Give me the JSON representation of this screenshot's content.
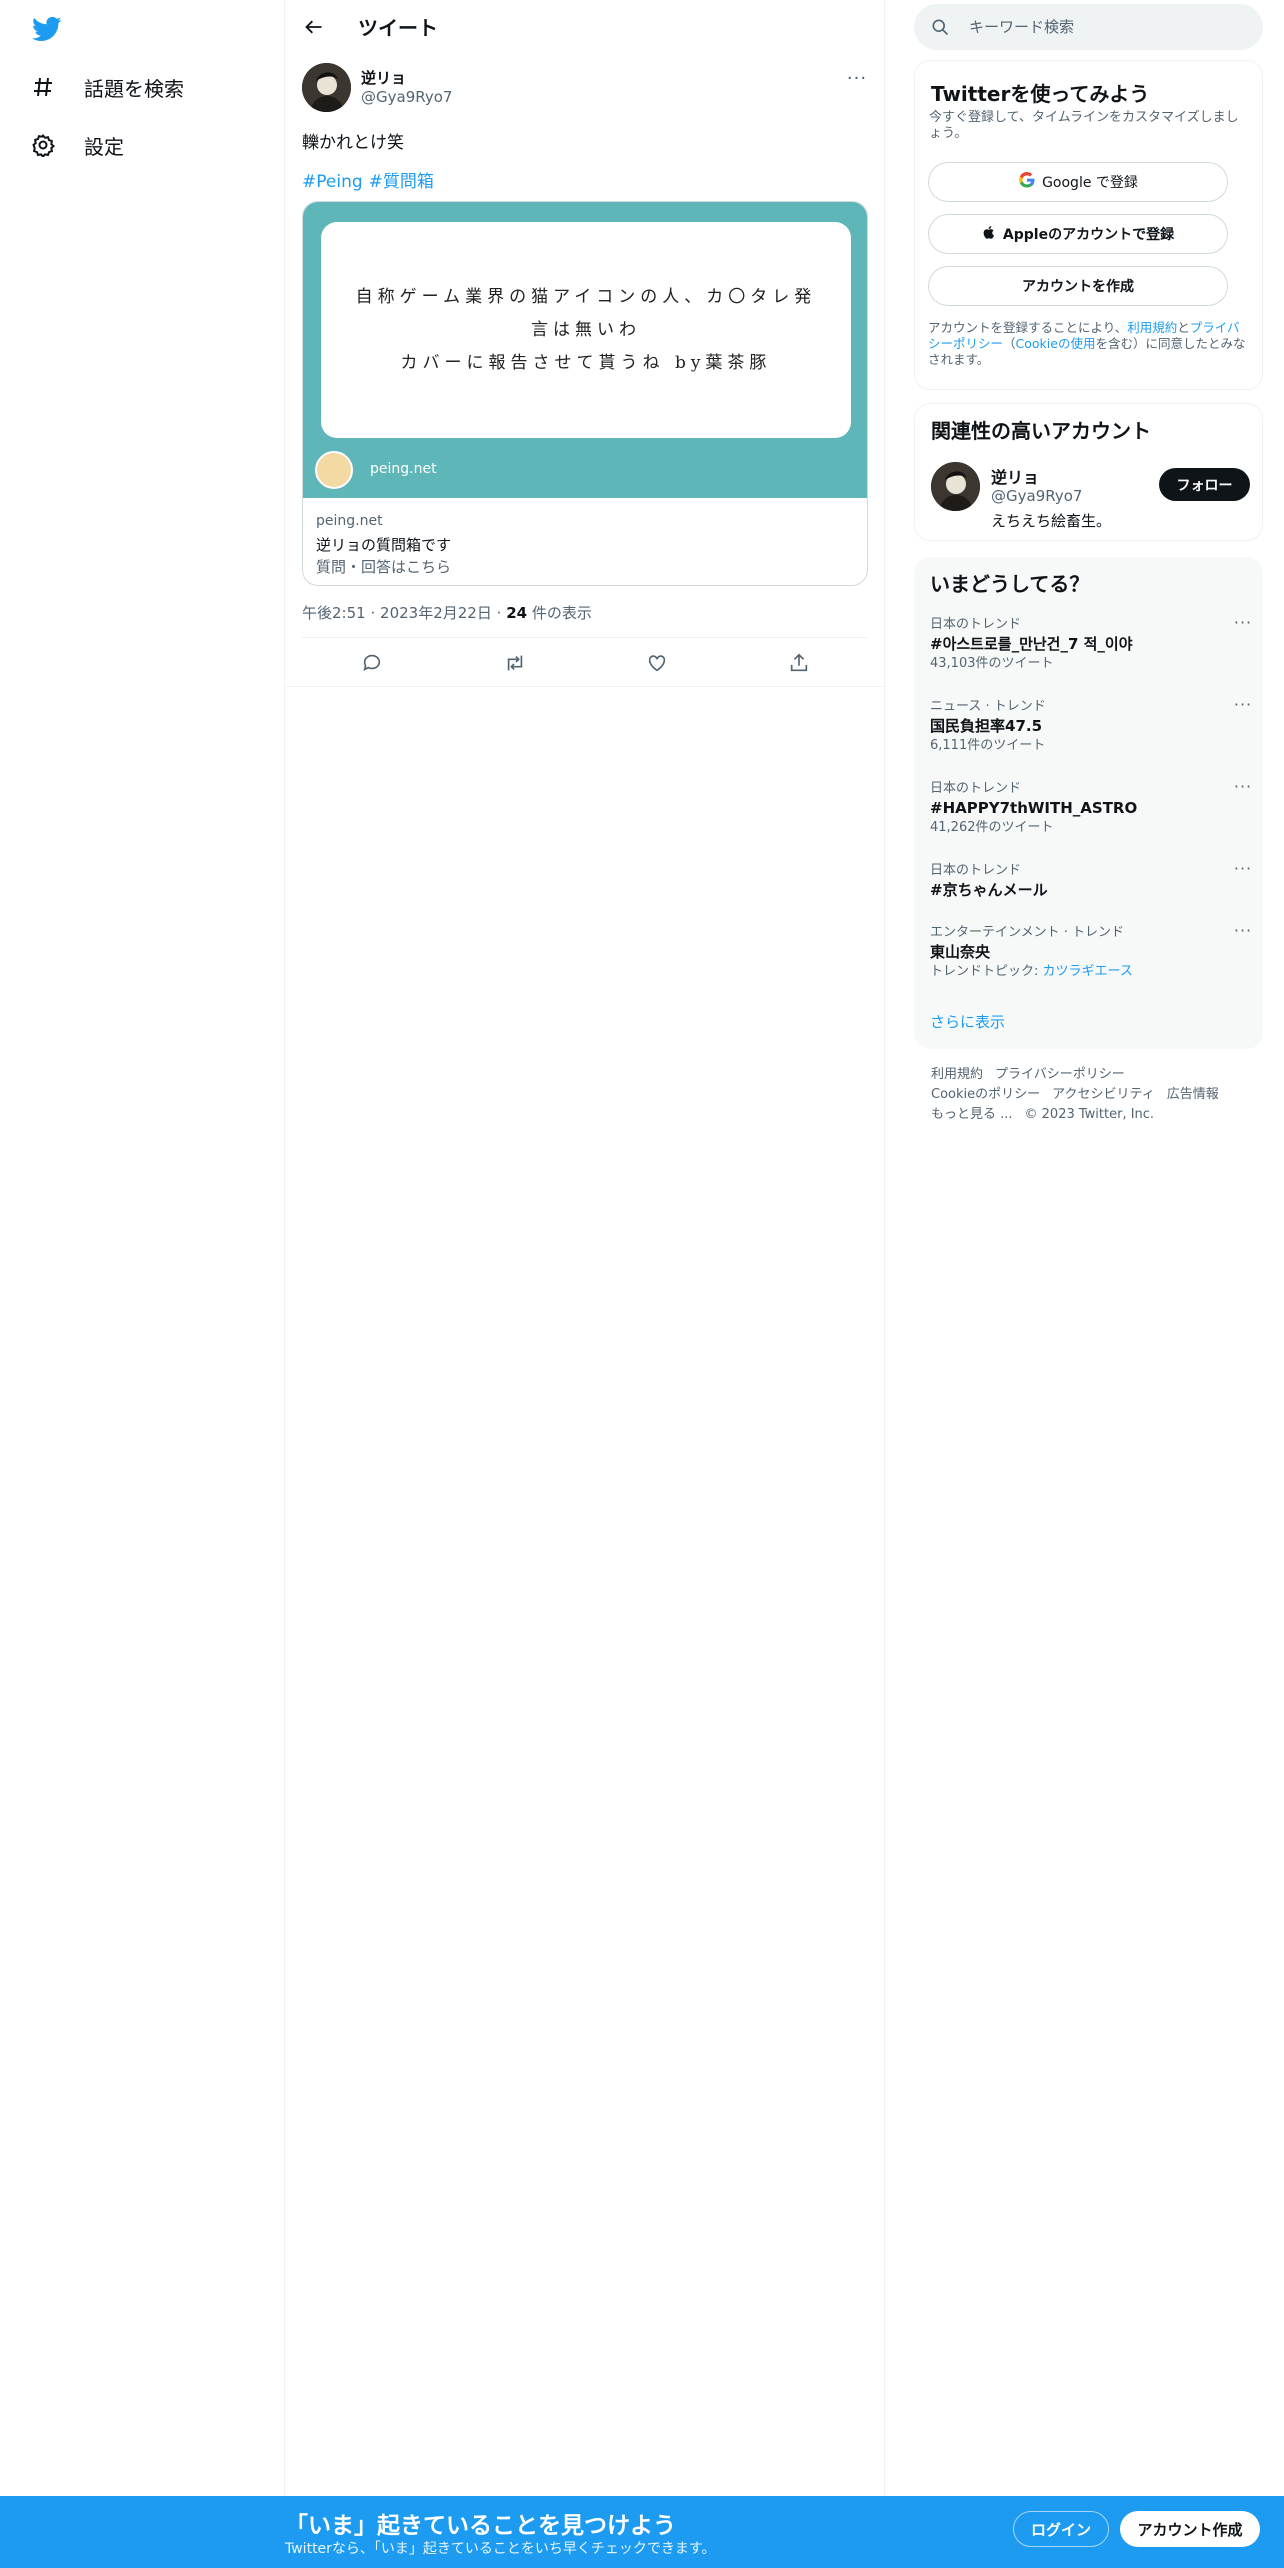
{
  "nav": {
    "explore_label": "話題を検索",
    "settings_label": "設定"
  },
  "header": {
    "title": "ツイート"
  },
  "tweet": {
    "author_name": "逆リョ",
    "author_handle": "@Gya9Ryo7",
    "text": "轢かれとけ笑",
    "hashtags": [
      "#Peing",
      "#質問箱"
    ],
    "card": {
      "image_lines": [
        "自称ゲーム業界の猫アイコンの人、カ〇タレ発",
        "言は無いわ",
        "カバーに報告させて貰うね by葉茶豚"
      ],
      "site_label": "peing.net",
      "domain": "peing.net",
      "title": "逆リョの質問箱です",
      "description": "質問・回答はこちら"
    },
    "time": "午後2:51",
    "date": "2023年2月22日",
    "views_count": "24",
    "views_label": "件の表示",
    "separator": "·"
  },
  "search": {
    "placeholder": "キーワード検索"
  },
  "signup": {
    "title": "Twitterを使ってみよう",
    "subtitle": "今すぐ登録して、タイムラインをカスタマイズしましょう。",
    "google_label": "Google で登録",
    "apple_label": "Appleのアカウントで登録",
    "create_label": "アカウントを作成",
    "legal_prefix": "アカウントを登録することにより、",
    "legal_terms": "利用規約",
    "legal_and": "と",
    "legal_privacy": "プライバシーポリシー",
    "legal_open": "（",
    "legal_cookie": "Cookieの使用",
    "legal_suffix": "を含む）に同意したとみなされます。"
  },
  "related": {
    "title": "関連性の高いアカウント",
    "name": "逆リョ",
    "handle": "@Gya9Ryo7",
    "bio": "えちえち絵畜生。",
    "follow_label": "フォロー"
  },
  "trends": {
    "title": "いまどうしてる？",
    "more_icon_label": "···",
    "items": [
      {
        "category": "日本のトレンド",
        "name": "#아스트로를_만난건_7 적_이야",
        "count": "43,103件のツイート"
      },
      {
        "category": "ニュース · トレンド",
        "name": "国民負担率47.5",
        "count": "6,111件のツイート"
      },
      {
        "category": "日本のトレンド",
        "name": "#HAPPY7thWITH_ASTRO",
        "count": "41,262件のツイート"
      },
      {
        "category": "日本のトレンド",
        "name": "#京ちゃんメール",
        "count": ""
      },
      {
        "category": "エンターテインメント · トレンド",
        "name": "東山奈央",
        "count_prefix": "トレンドトピック: ",
        "count_link": "カツラギエース"
      }
    ],
    "show_more": "さらに表示"
  },
  "footer": {
    "terms": "利用規約",
    "privacy": "プライバシーポリシー",
    "cookie": "Cookieのポリシー",
    "accessibility": "アクセシビリティ",
    "ads": "広告情報",
    "more": "もっと見る ...",
    "copyright": "© 2023 Twitter, Inc."
  },
  "bottom_bar": {
    "title": "「いま」起きていることを見つけよう",
    "subtitle": "Twitterなら、「いま」起きていることをいち早くチェックできます。",
    "login_label": "ログイン",
    "signup_label": "アカウント作成"
  },
  "colors": {
    "accent": "#1d9bf0",
    "card_bg": "#5fb6b8",
    "text_primary": "#0f1419",
    "text_secondary": "#536471"
  }
}
